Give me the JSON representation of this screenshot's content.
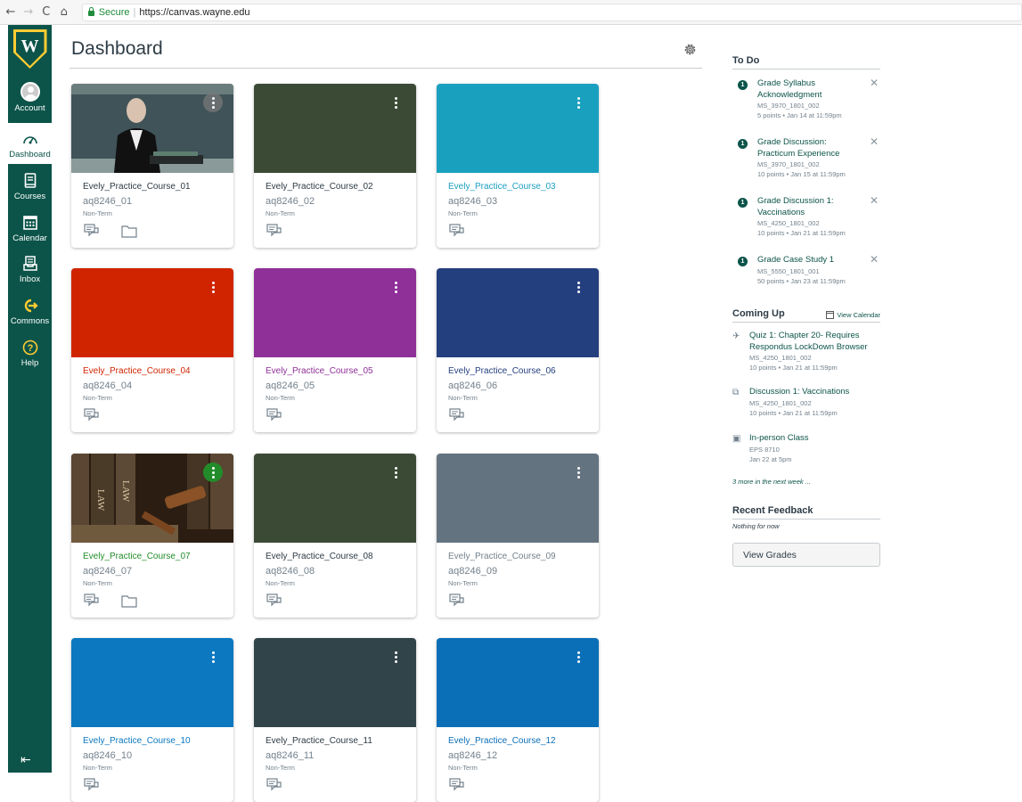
{
  "browser": {
    "secure_label": "Secure",
    "url": "https://canvas.wayne.edu"
  },
  "global_nav": {
    "items": [
      {
        "label": "Account",
        "icon": "account-avatar"
      },
      {
        "label": "Dashboard",
        "icon": "dashboard-icon"
      },
      {
        "label": "Courses",
        "icon": "courses-icon"
      },
      {
        "label": "Calendar",
        "icon": "calendar-icon"
      },
      {
        "label": "Inbox",
        "icon": "inbox-icon"
      },
      {
        "label": "Commons",
        "icon": "commons-icon"
      },
      {
        "label": "Help",
        "icon": "help-icon"
      }
    ],
    "brand_color": "#0c5449",
    "logo_accent": "#ffcc33"
  },
  "header": {
    "title": "Dashboard"
  },
  "cards": [
    {
      "name": "Evely_Practice_Course_01",
      "code": "aq8246_01",
      "term": "Non-Term",
      "color": "#c5d0d8",
      "name_color": "#2d3b45",
      "image": "man-at-podium",
      "folder": true
    },
    {
      "name": "Evely_Practice_Course_02",
      "code": "aq8246_02",
      "term": "Non-Term",
      "color": "#3b4a35",
      "name_color": "#2d3b45",
      "image": "",
      "folder": false
    },
    {
      "name": "Evely_Practice_Course_03",
      "code": "aq8246_03",
      "term": "Non-Term",
      "color": "#1aa0bf",
      "name_color": "#1a9fc0",
      "image": "",
      "folder": false
    },
    {
      "name": "Evely_Practice_Course_04",
      "code": "aq8246_04",
      "term": "Non-Term",
      "color": "#d02400",
      "name_color": "#d02400",
      "image": "",
      "folder": false
    },
    {
      "name": "Evely_Practice_Course_05",
      "code": "aq8246_05",
      "term": "Non-Term",
      "color": "#8f2f98",
      "name_color": "#8f2f98",
      "image": "",
      "folder": false
    },
    {
      "name": "Evely_Practice_Course_06",
      "code": "aq8246_06",
      "term": "Non-Term",
      "color": "#243f7e",
      "name_color": "#243f7e",
      "image": "",
      "folder": false
    },
    {
      "name": "Evely_Practice_Course_07",
      "code": "aq8246_07",
      "term": "Non-Term",
      "color": "#5b3a20",
      "name_color": "#238c2a",
      "image": "law-books-gavel",
      "folder": true
    },
    {
      "name": "Evely_Practice_Course_08",
      "code": "aq8246_08",
      "term": "Non-Term",
      "color": "#3b4a35",
      "name_color": "#2d3b45",
      "image": "",
      "folder": false
    },
    {
      "name": "Evely_Practice_Course_09",
      "code": "aq8246_09",
      "term": "Non-Term",
      "color": "#647380",
      "name_color": "#73818c",
      "image": "",
      "folder": false
    },
    {
      "name": "Evely_Practice_Course_10",
      "code": "aq8246_10",
      "term": "Non-Term",
      "color": "#0b78c0",
      "name_color": "#0b78c0",
      "image": "",
      "folder": false
    },
    {
      "name": "Evely_Practice_Course_11",
      "code": "aq8246_11",
      "term": "Non-Term",
      "color": "#31444a",
      "name_color": "#2d3b45",
      "image": "",
      "folder": false
    },
    {
      "name": "Evely_Practice_Course_12",
      "code": "aq8246_12",
      "term": "Non-Term",
      "color": "#0b6fb8",
      "name_color": "#0b6fb8",
      "image": "",
      "folder": false
    }
  ],
  "todo": {
    "heading": "To Do",
    "items": [
      {
        "badge": "1",
        "title": "Grade Syllabus Acknowledgment",
        "course": "MS_3970_1801_002",
        "detail": "5 points • Jan 14 at 11:59pm"
      },
      {
        "badge": "1",
        "title": "Grade Discussion: Practicum Experience",
        "course": "MS_3970_1801_002",
        "detail": "10 points • Jan 15 at 11:59pm"
      },
      {
        "badge": "1",
        "title": "Grade Discussion 1: Vaccinations",
        "course": "MS_4250_1801_002",
        "detail": "10 points • Jan 21 at 11:59pm"
      },
      {
        "badge": "1",
        "title": "Grade Case Study 1",
        "course": "MS_5550_1801_001",
        "detail": "50 points • Jan 23 at 11:59pm"
      }
    ]
  },
  "coming_up": {
    "heading": "Coming Up",
    "view_calendar": "View Calendar",
    "items": [
      {
        "icon": "quiz-rocket-icon",
        "title": "Quiz 1: Chapter 20- Requires Respondus LockDown Browser",
        "course": "MS_4250_1801_002",
        "detail": "10 points • Jan 21 at 11:59pm"
      },
      {
        "icon": "discussion-icon",
        "title": "Discussion 1: Vaccinations",
        "course": "MS_4250_1801_002",
        "detail": "10 points • Jan 21 at 11:59pm"
      },
      {
        "icon": "calendar-event-icon",
        "title": "In-person Class",
        "course": "EPS 8710",
        "detail": "Jan 22 at 5pm"
      }
    ],
    "more": "3 more in the next week ..."
  },
  "recent_feedback": {
    "heading": "Recent Feedback",
    "empty": "Nothing for now"
  },
  "view_grades": "View Grades"
}
